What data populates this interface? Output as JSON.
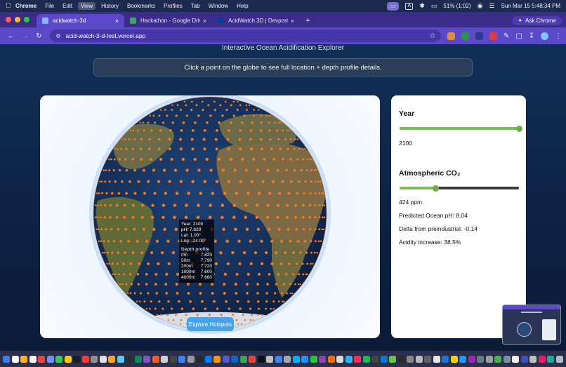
{
  "menubar": {
    "app_name": "Chrome",
    "items": [
      "File",
      "Edit",
      "View",
      "History",
      "Bookmarks",
      "Profiles",
      "Tab",
      "Window",
      "Help"
    ],
    "active_item": "View",
    "status_a": "A",
    "battery": "51% (1:02)",
    "datetime": "Sun Mar 15  5:48:34 PM"
  },
  "browser": {
    "tabs": [
      {
        "label": "acidwatch-3d",
        "active": true,
        "favicon_color": "#8ab4ff"
      },
      {
        "label": "Hackathon - Google Drive",
        "active": false,
        "favicon_color": "#34a853"
      },
      {
        "label": "AcidWatch 3D | Devpost",
        "active": false,
        "favicon_color": "#0b3d91"
      }
    ],
    "ask_button": "Ask Chrome",
    "url": "acid-watch-3-d-test.vercel.app"
  },
  "page": {
    "subtitle": "Interactive Ocean Acidification Explorer",
    "banner": "Click a point on the globe to see full location + depth profile details.",
    "tooltip": {
      "year": "Year: 2100",
      "ph": "pH: 7.820",
      "lat": "Lat: 1.00°",
      "lng": "Lng: -24.00°",
      "depth_title": "Depth profile",
      "depths": [
        {
          "depth": "0m",
          "ph": "7.820"
        },
        {
          "depth": "50m",
          "ph": "7.790"
        },
        {
          "depth": "200m",
          "ph": "7.720"
        },
        {
          "depth": "1000m",
          "ph": "7.600"
        },
        {
          "depth": "4000m",
          "ph": "7.660"
        }
      ]
    },
    "explore_button": "Explore Hotspots",
    "controls": {
      "year_label": "Year",
      "year_value": "2100",
      "year_fraction": 1.0,
      "co2_label": "Atmospheric CO₂",
      "co2_fraction": 0.3,
      "co2_value": "424 ppm",
      "predicted_ph": "Predicted Ocean pH: 8.04",
      "delta": "Delta from preindustrial: -0.14",
      "acidity": "Acidity increase: 38.5%"
    }
  },
  "colors": {
    "accent_purple": "#5b49c9",
    "slider_green": "#7cba5c",
    "hotspot_orange": "#f07b2b",
    "button_blue": "#4aa3e8"
  },
  "dock_colors": [
    "#3d7cf5",
    "#f5f5f5",
    "#ffb020",
    "#f2f2f2",
    "#e8453c",
    "#7a8cff",
    "#34c759",
    "#ffcc00",
    "#1d1d1f",
    "#ff3b30",
    "#8e8e93",
    "#e0e0e0",
    "#f5a623",
    "#5ac8fa",
    "#2e2e2e",
    "#0e8a5f",
    "#7d57c1",
    "#f15a24",
    "#d0d0d0",
    "#444",
    "#3c82f6",
    "#999",
    "#24292e",
    "#007aff",
    "#ff9500",
    "#5856d6",
    "#0a66c2",
    "#34a853",
    "#ea4335",
    "#111",
    "#c0c0c0",
    "#4285f4",
    "#a2aaad",
    "#00b3ff",
    "#2d8cff",
    "#28c840",
    "#8e44ad",
    "#ff6f00",
    "#d9d9d9",
    "#29b6f6",
    "#ff2d55",
    "#1db954",
    "#444",
    "#0078d4",
    "#6cc04a",
    "#2b2b2b",
    "#888",
    "#bbb",
    "#5f6368",
    "#e6e6e6",
    "#1976d2",
    "#ffcc00",
    "#2196f3",
    "#9c27b0",
    "#607d8b",
    "#9e9e9e",
    "#4caf50",
    "#78909c",
    "#f1f1f1",
    "#3f51b5",
    "#bdbdbd",
    "#e91e63",
    "#26a69a",
    "#b0bec5"
  ]
}
